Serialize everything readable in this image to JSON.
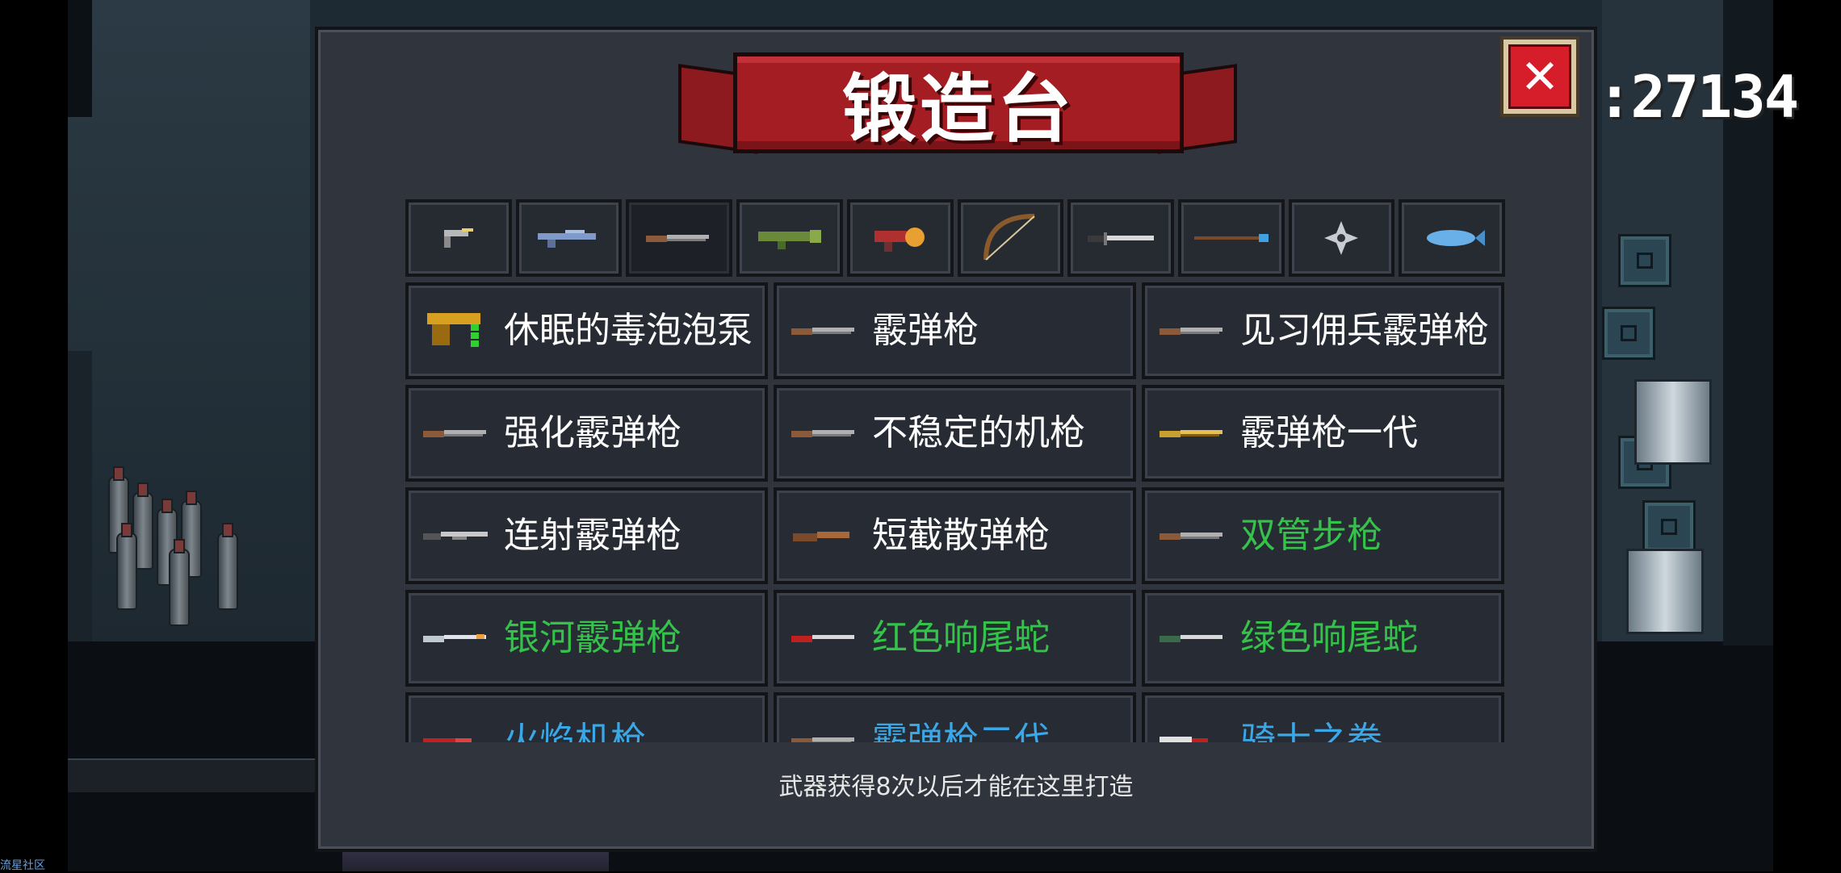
{
  "title": "锻造台",
  "gem_count": ":27134",
  "close_label": "✕",
  "hint": "武器获得8次以后才能在这里打造",
  "watermark": "流星社区",
  "tabs": [
    {
      "icon": "pistol-icon",
      "active": false
    },
    {
      "icon": "rifle-icon",
      "active": false
    },
    {
      "icon": "shotgun-icon",
      "active": true
    },
    {
      "icon": "launcher-icon",
      "active": false
    },
    {
      "icon": "flamethrower-icon",
      "active": false
    },
    {
      "icon": "bow-icon",
      "active": false
    },
    {
      "icon": "sword-icon",
      "active": false
    },
    {
      "icon": "staff-icon",
      "active": false
    },
    {
      "icon": "shuriken-icon",
      "active": false
    },
    {
      "icon": "fish-icon",
      "active": false
    }
  ],
  "weapons": [
    {
      "name": "休眠的毒泡泡泵",
      "color": "white",
      "icon": "bubble-pump-icon"
    },
    {
      "name": "霰弹枪",
      "color": "white",
      "icon": "shotgun-icon"
    },
    {
      "name": "见习佣兵霰弹枪",
      "color": "white",
      "icon": "shotgun-icon"
    },
    {
      "name": "强化霰弹枪",
      "color": "white",
      "icon": "shotgun-icon"
    },
    {
      "name": "不稳定的机枪",
      "color": "white",
      "icon": "shotgun-icon"
    },
    {
      "name": "霰弹枪一代",
      "color": "white",
      "icon": "gold-shotgun-icon"
    },
    {
      "name": "连射霰弹枪",
      "color": "white",
      "icon": "pump-shotgun-icon"
    },
    {
      "name": "短截散弹枪",
      "color": "white",
      "icon": "sawed-off-icon"
    },
    {
      "name": "双管步枪",
      "color": "green",
      "icon": "shotgun-icon"
    },
    {
      "name": "银河霰弹枪",
      "color": "green",
      "icon": "galaxy-shotgun-icon"
    },
    {
      "name": "红色响尾蛇",
      "color": "green",
      "icon": "red-shotgun-icon"
    },
    {
      "name": "绿色响尾蛇",
      "color": "green",
      "icon": "green-shotgun-icon"
    },
    {
      "name": "火焰机枪",
      "color": "blue",
      "icon": "fire-gun-icon"
    },
    {
      "name": "霰弹枪二代",
      "color": "blue",
      "icon": "shotgun-icon"
    },
    {
      "name": "骑士之拳",
      "color": "blue",
      "icon": "knight-fist-icon"
    }
  ]
}
